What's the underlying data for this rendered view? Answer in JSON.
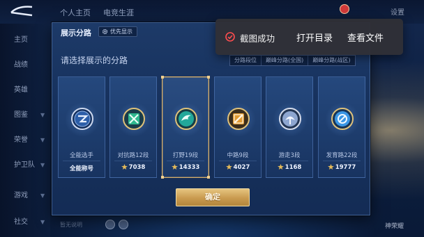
{
  "background": {
    "top_tabs": [
      "个人主页",
      "电竞生涯"
    ],
    "top_right_label": "设置",
    "sidebar_items": [
      {
        "label": "主页",
        "has_chevron": false
      },
      {
        "label": "战绩",
        "has_chevron": false
      },
      {
        "label": "英雄",
        "has_chevron": false
      },
      {
        "label": "图鉴",
        "has_chevron": true
      },
      {
        "label": "荣誉",
        "has_chevron": true
      },
      {
        "label": "护卫队",
        "has_chevron": true
      },
      {
        "label": "游戏",
        "has_chevron": true
      },
      {
        "label": "社交",
        "has_chevron": true
      }
    ],
    "chat_placeholder": "暂无说明",
    "hero_label": "神荣耀"
  },
  "dialog": {
    "title": "展示分路",
    "priority_label": "优先显示",
    "subtitle": "请选择展示的分路",
    "tabs": [
      {
        "label": "分路段位",
        "active": true
      },
      {
        "label": "巅峰分路(全国)",
        "active": false
      },
      {
        "label": "巅峰分路(战区)",
        "active": false
      }
    ],
    "cards": [
      {
        "name": "全能选手",
        "value": "全能称号",
        "show_star": false,
        "selected": false,
        "icon": "all-round-badge-icon",
        "color": "#7fa6e8"
      },
      {
        "name": "对抗路12段",
        "value": "7038",
        "show_star": true,
        "selected": false,
        "icon": "clash-lane-badge-icon",
        "color": "#38c49a"
      },
      {
        "name": "打野19段",
        "value": "14333",
        "show_star": true,
        "selected": true,
        "icon": "jungle-badge-icon",
        "color": "#2cb7a3"
      },
      {
        "name": "中路9段",
        "value": "4027",
        "show_star": true,
        "selected": false,
        "icon": "mid-lane-badge-icon",
        "color": "#e0a040"
      },
      {
        "name": "游走3段",
        "value": "1168",
        "show_star": true,
        "selected": false,
        "icon": "roam-badge-icon",
        "color": "#9ab0d8"
      },
      {
        "name": "发育路22段",
        "value": "19777",
        "show_star": true,
        "selected": false,
        "icon": "farm-lane-badge-icon",
        "color": "#3f9de8"
      }
    ],
    "confirm_label": "确定"
  },
  "toast": {
    "message": "截图成功",
    "open_dir_label": "打开目录",
    "view_file_label": "查看文件",
    "icon_color": "#ff4d4f"
  }
}
